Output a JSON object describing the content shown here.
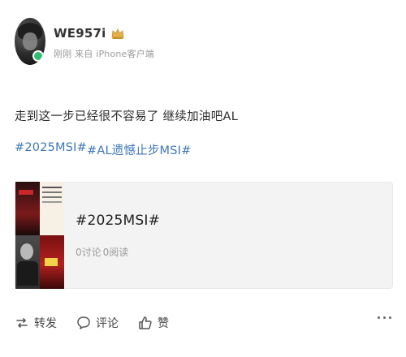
{
  "post": {
    "username": "WE957i",
    "meta": "刚刚 来自 iPhone客户端",
    "text": "走到这一步已经很不容易了 继续加油吧AL",
    "hashtags": [
      "#2025MSI#",
      "#AL遗憾止步MSI#"
    ]
  },
  "topic_card": {
    "title": "#2025MSI#",
    "discussions": "0讨论",
    "reads": "0阅读"
  },
  "actions": {
    "repost_label": "转发",
    "comment_label": "评论",
    "like_label": "赞"
  },
  "icons": {
    "crown": "crown-icon",
    "repost": "repost-icon",
    "comment": "comment-icon",
    "like": "like-icon",
    "more": "more-icon"
  },
  "colors": {
    "hashtag": "#3f78b6",
    "meta": "#9a9a9a",
    "card_bg": "#f3f3f3",
    "crown_gold": "#e3b04b"
  }
}
